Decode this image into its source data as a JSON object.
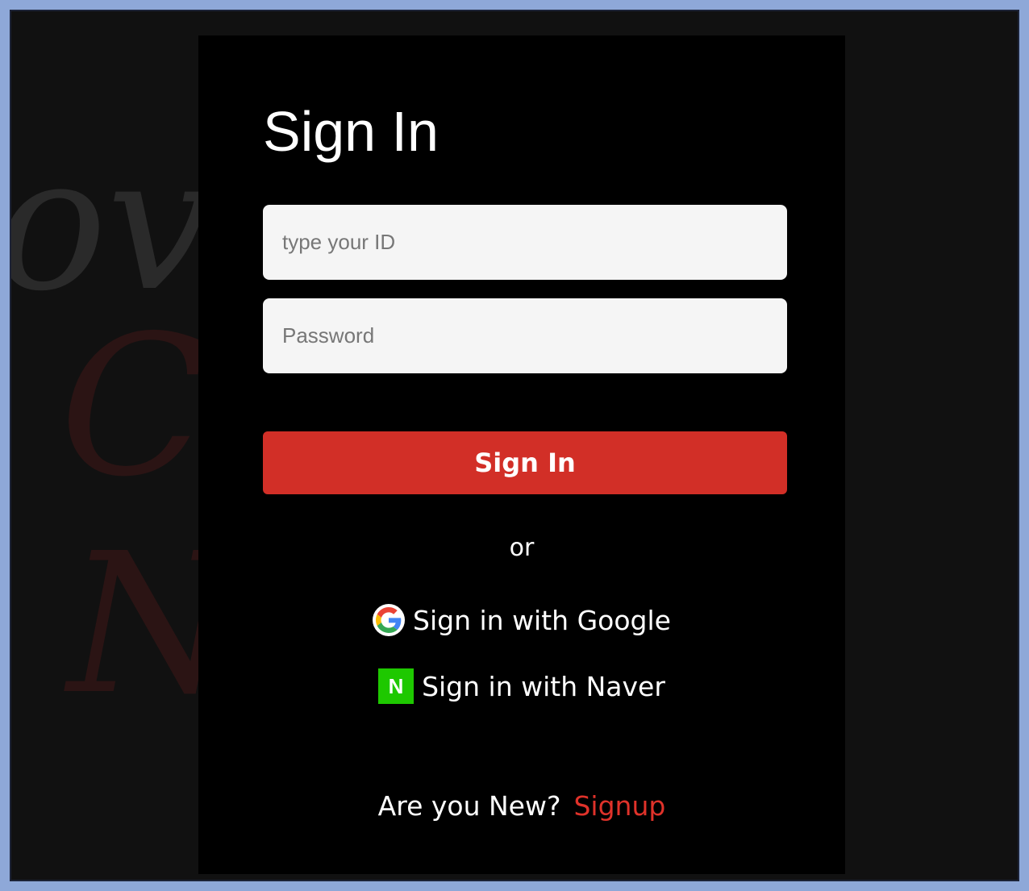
{
  "background": {
    "script_1": "ov",
    "script_2": "C",
    "script_3": "N"
  },
  "form": {
    "title": "Sign In",
    "id_placeholder": "type your ID",
    "password_placeholder": "Password",
    "submit_label": "Sign In",
    "divider": "or"
  },
  "social": {
    "google_label": "Sign in with Google",
    "naver_label": "Sign in with Naver",
    "naver_icon_letter": "N"
  },
  "footer": {
    "prompt": "Are you New?",
    "signup_label": "Signup"
  },
  "colors": {
    "frame_border": "#8ea8d8",
    "page_bg": "#111111",
    "card_bg": "#000000",
    "accent_red": "#d22f27",
    "naver_green": "#1ec800"
  },
  "icons": [
    "google-icon",
    "naver-icon"
  ]
}
